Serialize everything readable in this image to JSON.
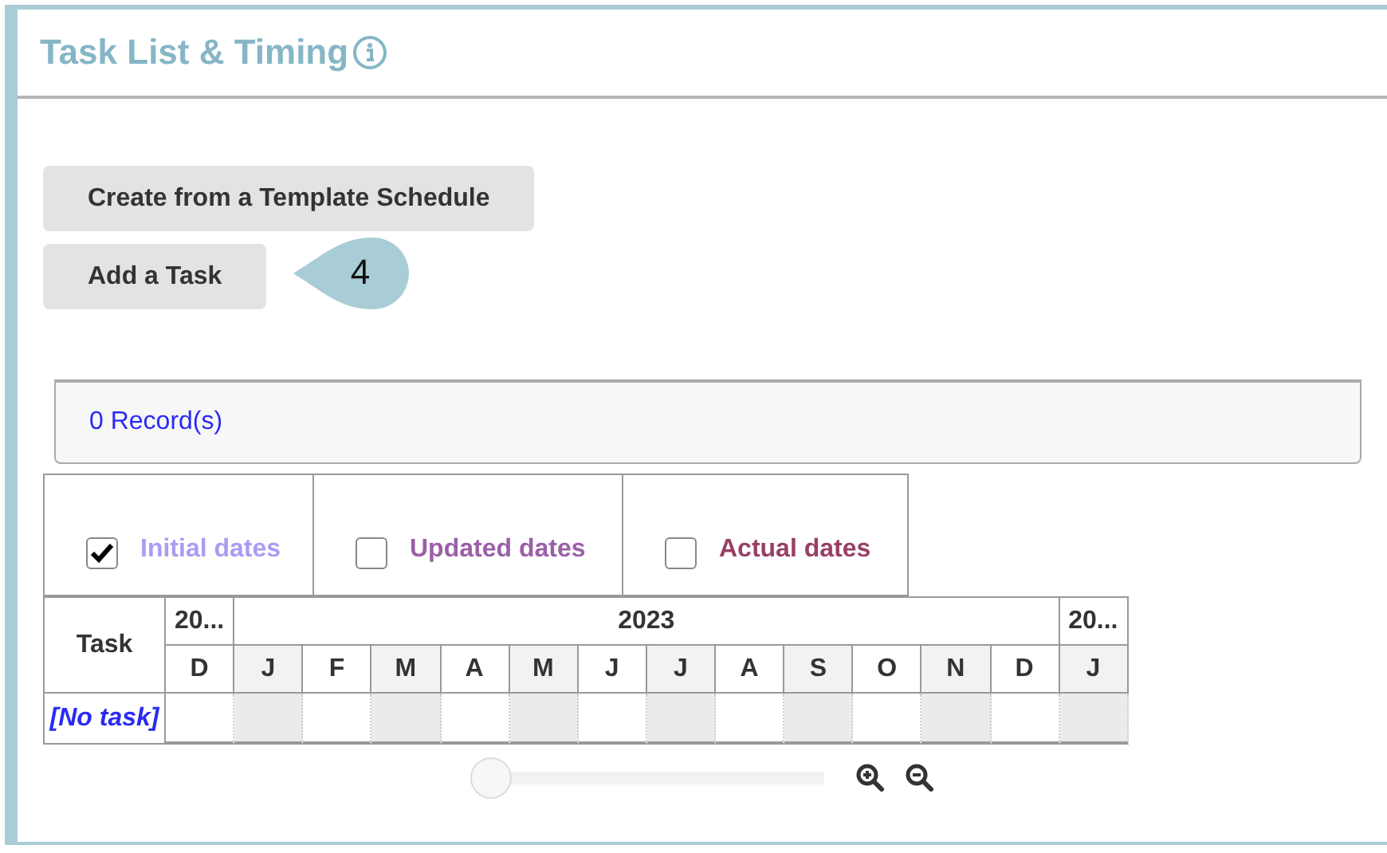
{
  "panel": {
    "title": "Task List & Timing"
  },
  "buttons": [
    {
      "label": "Create from a Template Schedule"
    },
    {
      "label": "Add a Task",
      "callout": "4"
    }
  ],
  "records": {
    "label": "0 Record(s)"
  },
  "legend": [
    {
      "label": "Initial dates",
      "checked": true,
      "color": "#a99cf3"
    },
    {
      "label": "Updated dates",
      "checked": false,
      "color": "#9b5fa8"
    },
    {
      "label": "Actual dates",
      "checked": false,
      "color": "#993f66"
    }
  ],
  "gantt": {
    "task_header": "Task",
    "years": [
      {
        "label": "20...",
        "months": [
          {
            "label": "D",
            "shaded": false
          }
        ]
      },
      {
        "label": "2023",
        "months": [
          {
            "label": "J",
            "shaded": true
          },
          {
            "label": "F",
            "shaded": false
          },
          {
            "label": "M",
            "shaded": true
          },
          {
            "label": "A",
            "shaded": false
          },
          {
            "label": "M",
            "shaded": true
          },
          {
            "label": "J",
            "shaded": false
          },
          {
            "label": "J",
            "shaded": true
          },
          {
            "label": "A",
            "shaded": false
          },
          {
            "label": "S",
            "shaded": true
          },
          {
            "label": "O",
            "shaded": false
          },
          {
            "label": "N",
            "shaded": true
          },
          {
            "label": "D",
            "shaded": false
          }
        ]
      },
      {
        "label": "20...",
        "months": [
          {
            "label": "J",
            "shaded": true
          }
        ]
      }
    ],
    "tasks": [
      {
        "label": "[No task]"
      }
    ]
  },
  "zoom": {
    "level": 0
  }
}
